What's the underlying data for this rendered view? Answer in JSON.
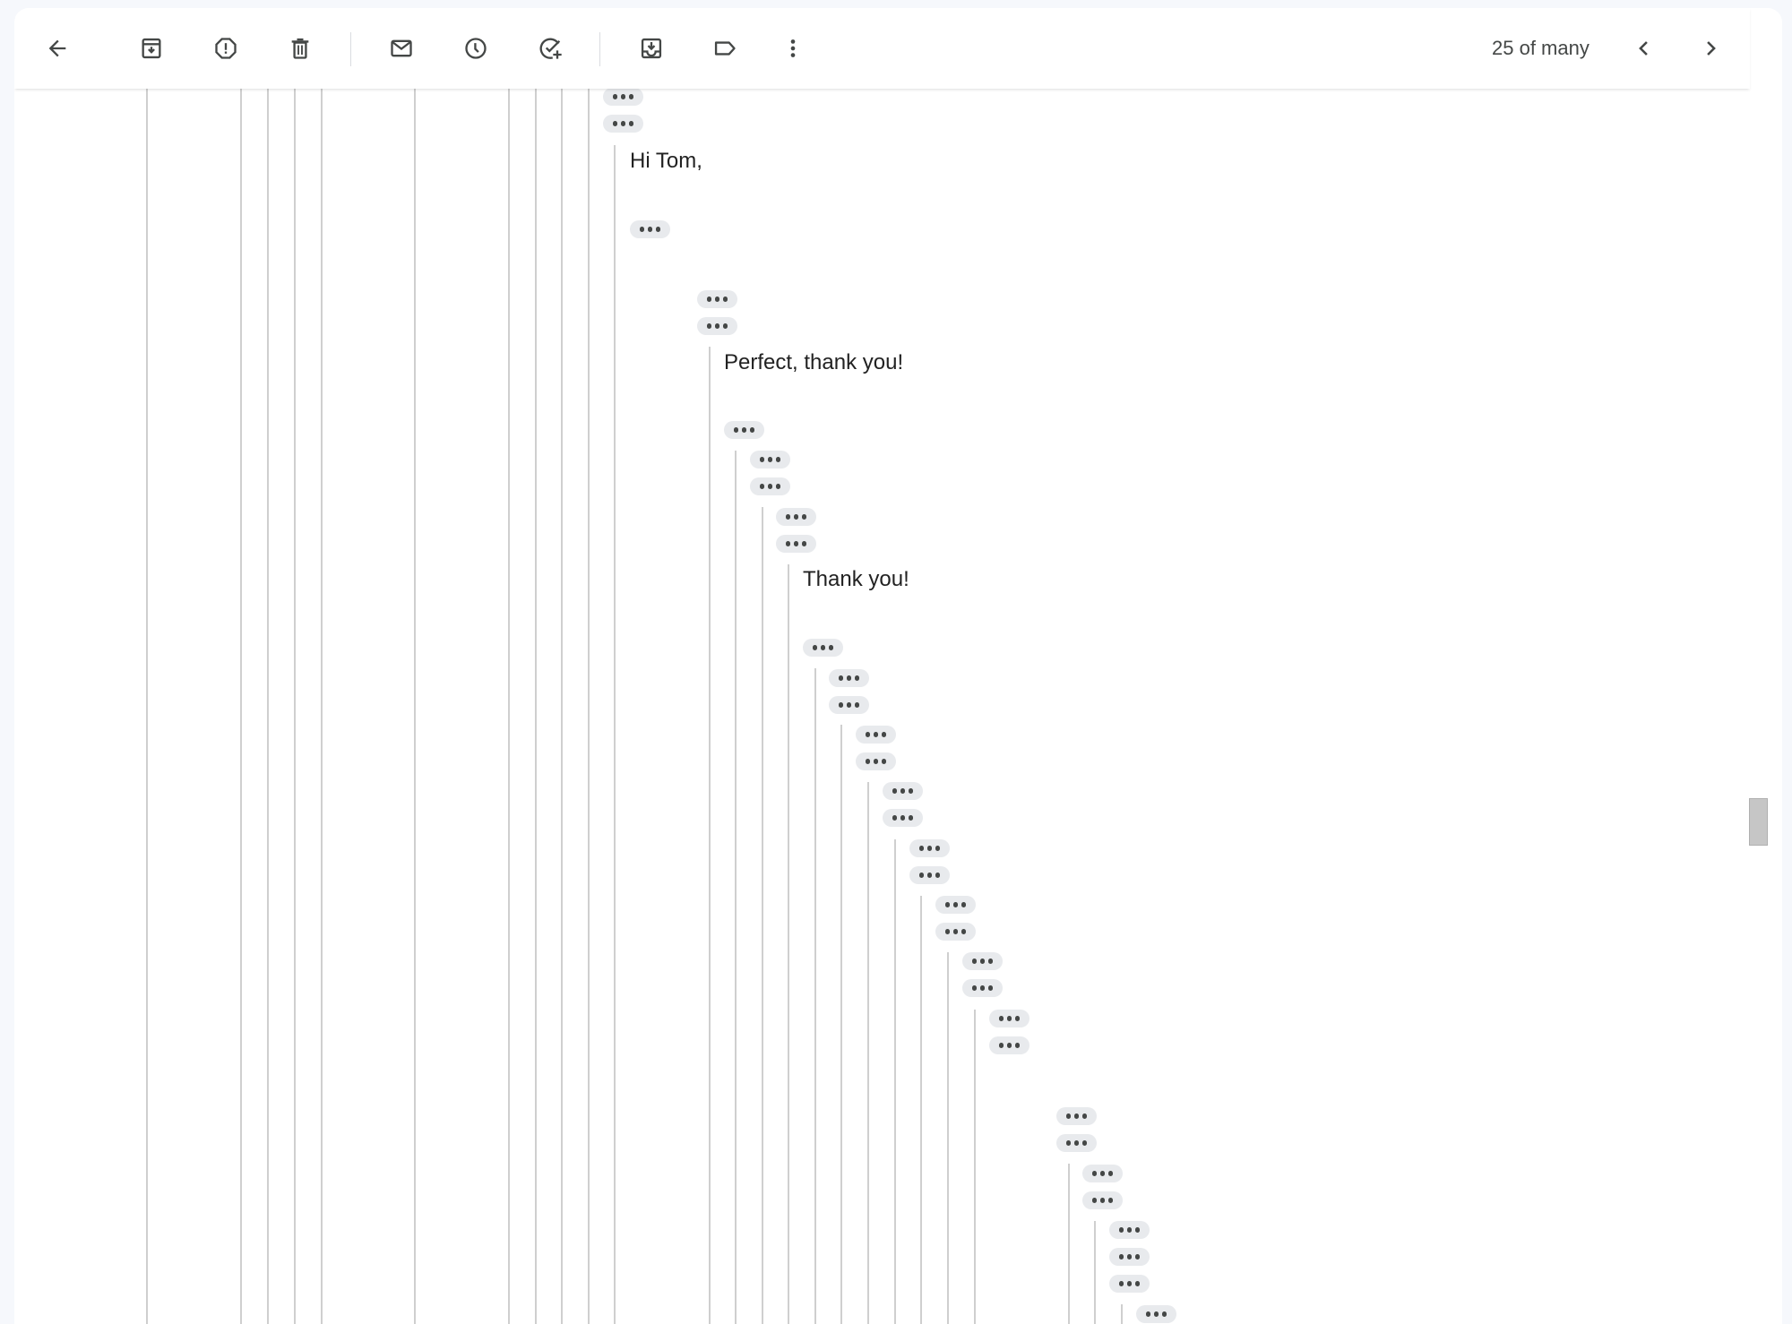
{
  "toolbar": {
    "buttons": [
      {
        "name": "back-button",
        "icon": "arrow-left-icon",
        "label": "Back to Inbox"
      },
      {
        "name": "archive-button",
        "icon": "archive-icon",
        "label": "Archive"
      },
      {
        "name": "report-spam-button",
        "icon": "report-spam-icon",
        "label": "Report spam"
      },
      {
        "name": "delete-button",
        "icon": "trash-icon",
        "label": "Delete"
      },
      {
        "name": "mark-unread-button",
        "icon": "mail-icon",
        "label": "Mark as unread"
      },
      {
        "name": "snooze-button",
        "icon": "clock-icon",
        "label": "Snooze"
      },
      {
        "name": "add-to-tasks-button",
        "icon": "add-task-icon",
        "label": "Add to Tasks"
      },
      {
        "name": "move-to-button",
        "icon": "move-to-inbox-icon",
        "label": "Move to"
      },
      {
        "name": "labels-button",
        "icon": "label-icon",
        "label": "Labels"
      },
      {
        "name": "more-button",
        "icon": "more-vert-icon",
        "label": "More"
      }
    ],
    "pagination": {
      "count_text": "25 of many",
      "prev_icon": "chevron-left-icon",
      "next_icon": "chevron-right-icon"
    }
  },
  "thread": {
    "messages": [
      {
        "text": "Hi Tom,"
      },
      {
        "text": "Perfect, thank you!"
      },
      {
        "text": "Thank you!"
      }
    ],
    "collapsed_quote_label": "•••",
    "collapsed_quote_count": 33
  },
  "colors": {
    "background": "#f6f8fc",
    "card": "#ffffff",
    "pill": "#e8eaed",
    "icon": "#444746",
    "quote_line": "#cfcfcf"
  }
}
